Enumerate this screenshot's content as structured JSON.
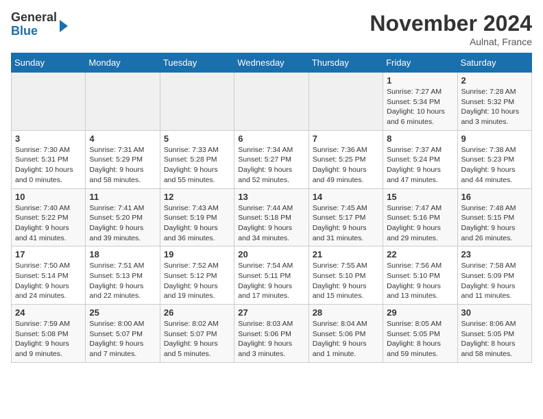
{
  "logo": {
    "general": "General",
    "blue": "Blue"
  },
  "header": {
    "month": "November 2024",
    "location": "Aulnat, France"
  },
  "weekdays": [
    "Sunday",
    "Monday",
    "Tuesday",
    "Wednesday",
    "Thursday",
    "Friday",
    "Saturday"
  ],
  "weeks": [
    [
      {
        "day": "",
        "info": ""
      },
      {
        "day": "",
        "info": ""
      },
      {
        "day": "",
        "info": ""
      },
      {
        "day": "",
        "info": ""
      },
      {
        "day": "",
        "info": ""
      },
      {
        "day": "1",
        "info": "Sunrise: 7:27 AM\nSunset: 5:34 PM\nDaylight: 10 hours and 6 minutes."
      },
      {
        "day": "2",
        "info": "Sunrise: 7:28 AM\nSunset: 5:32 PM\nDaylight: 10 hours and 3 minutes."
      }
    ],
    [
      {
        "day": "3",
        "info": "Sunrise: 7:30 AM\nSunset: 5:31 PM\nDaylight: 10 hours and 0 minutes."
      },
      {
        "day": "4",
        "info": "Sunrise: 7:31 AM\nSunset: 5:29 PM\nDaylight: 9 hours and 58 minutes."
      },
      {
        "day": "5",
        "info": "Sunrise: 7:33 AM\nSunset: 5:28 PM\nDaylight: 9 hours and 55 minutes."
      },
      {
        "day": "6",
        "info": "Sunrise: 7:34 AM\nSunset: 5:27 PM\nDaylight: 9 hours and 52 minutes."
      },
      {
        "day": "7",
        "info": "Sunrise: 7:36 AM\nSunset: 5:25 PM\nDaylight: 9 hours and 49 minutes."
      },
      {
        "day": "8",
        "info": "Sunrise: 7:37 AM\nSunset: 5:24 PM\nDaylight: 9 hours and 47 minutes."
      },
      {
        "day": "9",
        "info": "Sunrise: 7:38 AM\nSunset: 5:23 PM\nDaylight: 9 hours and 44 minutes."
      }
    ],
    [
      {
        "day": "10",
        "info": "Sunrise: 7:40 AM\nSunset: 5:22 PM\nDaylight: 9 hours and 41 minutes."
      },
      {
        "day": "11",
        "info": "Sunrise: 7:41 AM\nSunset: 5:20 PM\nDaylight: 9 hours and 39 minutes."
      },
      {
        "day": "12",
        "info": "Sunrise: 7:43 AM\nSunset: 5:19 PM\nDaylight: 9 hours and 36 minutes."
      },
      {
        "day": "13",
        "info": "Sunrise: 7:44 AM\nSunset: 5:18 PM\nDaylight: 9 hours and 34 minutes."
      },
      {
        "day": "14",
        "info": "Sunrise: 7:45 AM\nSunset: 5:17 PM\nDaylight: 9 hours and 31 minutes."
      },
      {
        "day": "15",
        "info": "Sunrise: 7:47 AM\nSunset: 5:16 PM\nDaylight: 9 hours and 29 minutes."
      },
      {
        "day": "16",
        "info": "Sunrise: 7:48 AM\nSunset: 5:15 PM\nDaylight: 9 hours and 26 minutes."
      }
    ],
    [
      {
        "day": "17",
        "info": "Sunrise: 7:50 AM\nSunset: 5:14 PM\nDaylight: 9 hours and 24 minutes."
      },
      {
        "day": "18",
        "info": "Sunrise: 7:51 AM\nSunset: 5:13 PM\nDaylight: 9 hours and 22 minutes."
      },
      {
        "day": "19",
        "info": "Sunrise: 7:52 AM\nSunset: 5:12 PM\nDaylight: 9 hours and 19 minutes."
      },
      {
        "day": "20",
        "info": "Sunrise: 7:54 AM\nSunset: 5:11 PM\nDaylight: 9 hours and 17 minutes."
      },
      {
        "day": "21",
        "info": "Sunrise: 7:55 AM\nSunset: 5:10 PM\nDaylight: 9 hours and 15 minutes."
      },
      {
        "day": "22",
        "info": "Sunrise: 7:56 AM\nSunset: 5:10 PM\nDaylight: 9 hours and 13 minutes."
      },
      {
        "day": "23",
        "info": "Sunrise: 7:58 AM\nSunset: 5:09 PM\nDaylight: 9 hours and 11 minutes."
      }
    ],
    [
      {
        "day": "24",
        "info": "Sunrise: 7:59 AM\nSunset: 5:08 PM\nDaylight: 9 hours and 9 minutes."
      },
      {
        "day": "25",
        "info": "Sunrise: 8:00 AM\nSunset: 5:07 PM\nDaylight: 9 hours and 7 minutes."
      },
      {
        "day": "26",
        "info": "Sunrise: 8:02 AM\nSunset: 5:07 PM\nDaylight: 9 hours and 5 minutes."
      },
      {
        "day": "27",
        "info": "Sunrise: 8:03 AM\nSunset: 5:06 PM\nDaylight: 9 hours and 3 minutes."
      },
      {
        "day": "28",
        "info": "Sunrise: 8:04 AM\nSunset: 5:06 PM\nDaylight: 9 hours and 1 minute."
      },
      {
        "day": "29",
        "info": "Sunrise: 8:05 AM\nSunset: 5:05 PM\nDaylight: 8 hours and 59 minutes."
      },
      {
        "day": "30",
        "info": "Sunrise: 8:06 AM\nSunset: 5:05 PM\nDaylight: 8 hours and 58 minutes."
      }
    ]
  ]
}
